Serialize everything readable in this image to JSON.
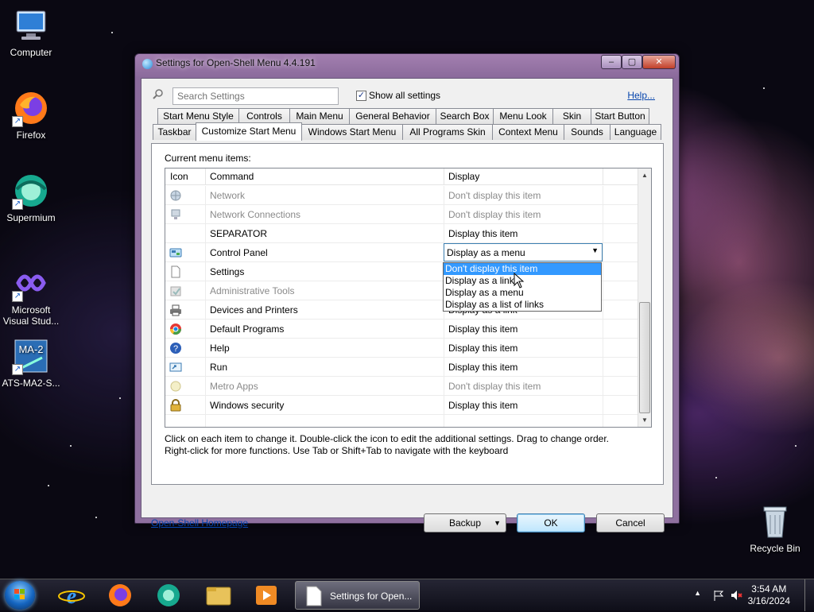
{
  "desktop": {
    "icons": [
      {
        "label": "Computer",
        "icon": "computer-icon"
      },
      {
        "label": "Firefox",
        "icon": "firefox-icon"
      },
      {
        "label": "Supermium",
        "icon": "supermium-icon"
      },
      {
        "label": "Microsoft Visual Stud...",
        "icon": "visual-studio-icon"
      },
      {
        "label": "ATS-MA2-S...",
        "icon": "ma2-icon"
      },
      {
        "label": "Recycle Bin",
        "icon": "recycle-bin-icon"
      }
    ]
  },
  "window": {
    "title": "Settings for Open-Shell Menu 4.4.191",
    "controls": {
      "minimize": "–",
      "maximize": "▢",
      "close": "✕"
    },
    "search": {
      "placeholder": "Search Settings"
    },
    "show_all": {
      "label": "Show all settings",
      "checked": true
    },
    "help_link": "Help...",
    "tabs_row1": [
      "Start Menu Style",
      "Controls",
      "Main Menu",
      "General Behavior",
      "Search Box",
      "Menu Look",
      "Skin",
      "Start Button"
    ],
    "tabs_row2": [
      "Taskbar",
      "Customize Start Menu",
      "Windows Start Menu",
      "All Programs Skin",
      "Context Menu",
      "Sounds",
      "Language"
    ],
    "active_tab": "Customize Start Menu",
    "list_label": "Current menu items:",
    "columns": {
      "icon": "Icon",
      "command": "Command",
      "display": "Display"
    },
    "rows": [
      {
        "icon": "network-icon",
        "command": "Network",
        "display": "Don't display this item",
        "dim": true
      },
      {
        "icon": "network-connections-icon",
        "command": "Network Connections",
        "display": "Don't display this item",
        "dim": true
      },
      {
        "icon": "",
        "command": "SEPARATOR",
        "display": "Display this item",
        "dim": false
      },
      {
        "icon": "control-panel-icon",
        "command": "Control Panel",
        "display": "Display as a menu",
        "dim": false
      },
      {
        "icon": "document-icon",
        "command": "Settings",
        "display": "",
        "dim": false
      },
      {
        "icon": "administrative-tools-icon",
        "command": "Administrative Tools",
        "display": "",
        "dim": true
      },
      {
        "icon": "printer-icon",
        "command": "Devices and Printers",
        "display": "Display as a link",
        "dim": false
      },
      {
        "icon": "default-programs-icon",
        "command": "Default Programs",
        "display": "Display this item",
        "dim": false
      },
      {
        "icon": "help-icon",
        "command": "Help",
        "display": "Display this item",
        "dim": false
      },
      {
        "icon": "run-icon",
        "command": "Run",
        "display": "Display this item",
        "dim": false
      },
      {
        "icon": "metro-apps-icon",
        "command": "Metro Apps",
        "display": "Don't display this item",
        "dim": true
      },
      {
        "icon": "lock-icon",
        "command": "Windows security",
        "display": "Display this item",
        "dim": false
      }
    ],
    "combo": {
      "value": "Display as a menu"
    },
    "dropdown_options": [
      "Don't display this item",
      "Display as a link",
      "Display as a menu",
      "Display as a list of links"
    ],
    "dropdown_selected": "Don't display this item",
    "hint_line1": "Click on each item to change it. Double-click the icon to edit the additional settings. Drag to change order.",
    "hint_line2": "Right-click for more functions. Use Tab or Shift+Tab to navigate with the keyboard",
    "homepage_link": "Open-Shell Homepage",
    "buttons": {
      "backup": "Backup",
      "ok": "OK",
      "cancel": "Cancel"
    }
  },
  "taskbar": {
    "pinned": [
      "internet-explorer-icon",
      "firefox-icon",
      "supermium-icon",
      "file-explorer-icon",
      "media-player-icon"
    ],
    "task_label": "Settings for Open...",
    "clock_time": "3:54 AM",
    "clock_date": "3/16/2024"
  },
  "colors": {
    "accent": "#3399ff",
    "link": "#0645ad",
    "titlebar": "#a37fb0"
  }
}
